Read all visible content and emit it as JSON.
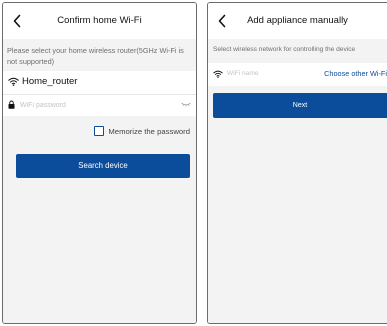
{
  "colors": {
    "accent": "#0c4d9b",
    "background": "#f3f3f3",
    "text_muted": "#6f6f6f",
    "placeholder": "#c4c4c4"
  },
  "screen1": {
    "title": "Confirm home Wi-Fi",
    "back_icon": "chevron-left-icon",
    "description": "Please select your home wireless router(5GHz Wi-Fi is not supported)",
    "ssid": "Home_router",
    "wifi_icon": "wifi-icon",
    "lock_icon": "lock-icon",
    "password_value": "",
    "password_placeholder": "WiFi password",
    "eye_icon": "eye-closed-icon",
    "memorize_label": "Memorize the password",
    "memorize_checked": false,
    "search_button": "Search device"
  },
  "screen2": {
    "title": "Add appliance manually",
    "back_icon": "chevron-left-icon",
    "description": "Select wireless network for controlling the device",
    "wifi_icon": "wifi-icon",
    "wifi_placeholder": "WiFi name",
    "choose_link": "Choose other Wi-Fi",
    "next_button": "Next"
  }
}
